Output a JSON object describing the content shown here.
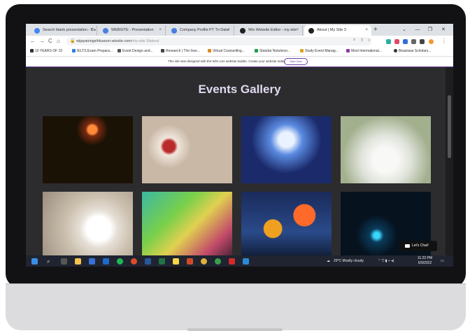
{
  "browser": {
    "tabs": [
      {
        "title": "Search blank presentation - Ca",
        "fav": "#4285f4"
      },
      {
        "title": "WEBSITE - Presentation",
        "fav": "#4a7fe0"
      },
      {
        "title": "Company Profile PT Tri Data",
        "fav": "#4a7fe0"
      },
      {
        "title": "Wix Website Editor - my-site",
        "fav": "#222222"
      },
      {
        "title": "About | My Site 3",
        "fav": "#222222"
      }
    ],
    "new_tab": "+",
    "window_controls": [
      "⌄",
      "—",
      "❐",
      "✕"
    ],
    "nav": [
      "←",
      "→",
      "C",
      "⌂"
    ],
    "url_host": "wijayaningsihkusum.wixsite.com",
    "url_path": "/my-site-3/about",
    "bookmarks": [
      {
        "label": "10 YEARS OF 10",
        "color": "#333333"
      },
      {
        "label": "IELTS Exam Prepara...",
        "color": "#2f7de1"
      },
      {
        "label": "Event Design and...",
        "color": "#555555"
      },
      {
        "label": "Research | The Inse...",
        "color": "#444444"
      },
      {
        "label": "Virtual Counselling...",
        "color": "#e08a1e"
      },
      {
        "label": "Standar Notulensi...",
        "color": "#1e9e4a"
      },
      {
        "label": "Study Event Manag...",
        "color": "#e0a21e"
      },
      {
        "label": "Most International...",
        "color": "#8e3aa6"
      },
      {
        "label": "Beasiswa Scholars...",
        "color": "#333333"
      }
    ],
    "wix_banner": {
      "text": "This site was designed with the WIX.com website builder. Create your website today.",
      "button": "Start Now"
    }
  },
  "page": {
    "title": "Events Gallery",
    "gallery": [
      {
        "name": "fireworks-photo",
        "bg": "radial-gradient(circle at 55% 20%, #ff8a3a 0 6%, #7a2a10 9%, #1a1205 22%), linear-gradient(#111 55%, #c98a2a 75%, #3a2608 100%)"
      },
      {
        "name": "dessert-photo",
        "bg": "radial-gradient(circle at 30% 45%, #b92b2b 0 8%, #f0e6dc 12%, #c9b8a6 30%), radial-gradient(circle at 78% 70%, #a8242a 0 7%, #efe4d8 11%, #8a7a6a 28%), #6a5a4a"
      },
      {
        "name": "concert-photo",
        "bg": "radial-gradient(ellipse at 50% 35%, #eaf2ff 0 12%, #5a8ae0 25%, #1a2a6a 55%), linear-gradient(transparent 65%, #0a0a18 100%)"
      },
      {
        "name": "banquet-photo",
        "bg": "radial-gradient(circle at 50% 65%, #f8f8f6 0 20%, #dfe3da 40%, #a3b08e 70%), linear-gradient(#cfc9bb, #e9e8e2)"
      },
      {
        "name": "table-setting-photo",
        "bg": "radial-gradient(circle at 62% 55%, #ffffff 0 18%, #e6dfd6 28%, #cbbfae 50%, #9a8d7e 100%)"
      },
      {
        "name": "festival-crowd-photo",
        "bg": "linear-gradient(135deg, #3ab8a2 0%, #7ad04a 35%, #e0d050 55%, #c24a6a 80%, #402030 100%)"
      },
      {
        "name": "hot-air-balloons-photo",
        "bg": "radial-gradient(circle at 70% 35%, #ff6a2a 0 14%, transparent 15%), radial-gradient(circle at 35% 55%, #f0a020 0 13%, transparent 14%), linear-gradient(#1a2a5a, #2a4a8a 60%, #0e1a30 100%)"
      },
      {
        "name": "dj-turntable-photo",
        "bg": "radial-gradient(circle at 40% 65%, #38d8ff 0 4%, #0a3a5a 10%, #06121e 30%), radial-gradient(circle at 80% 40%, #2ab0ff 0 3%, transparent 12%), #06101a"
      }
    ],
    "chat_label": "Let's Chat!"
  },
  "taskbar": {
    "weather": "29°C  Mostly cloudy",
    "time": "11:22 PM",
    "date": "6/9/2022"
  }
}
